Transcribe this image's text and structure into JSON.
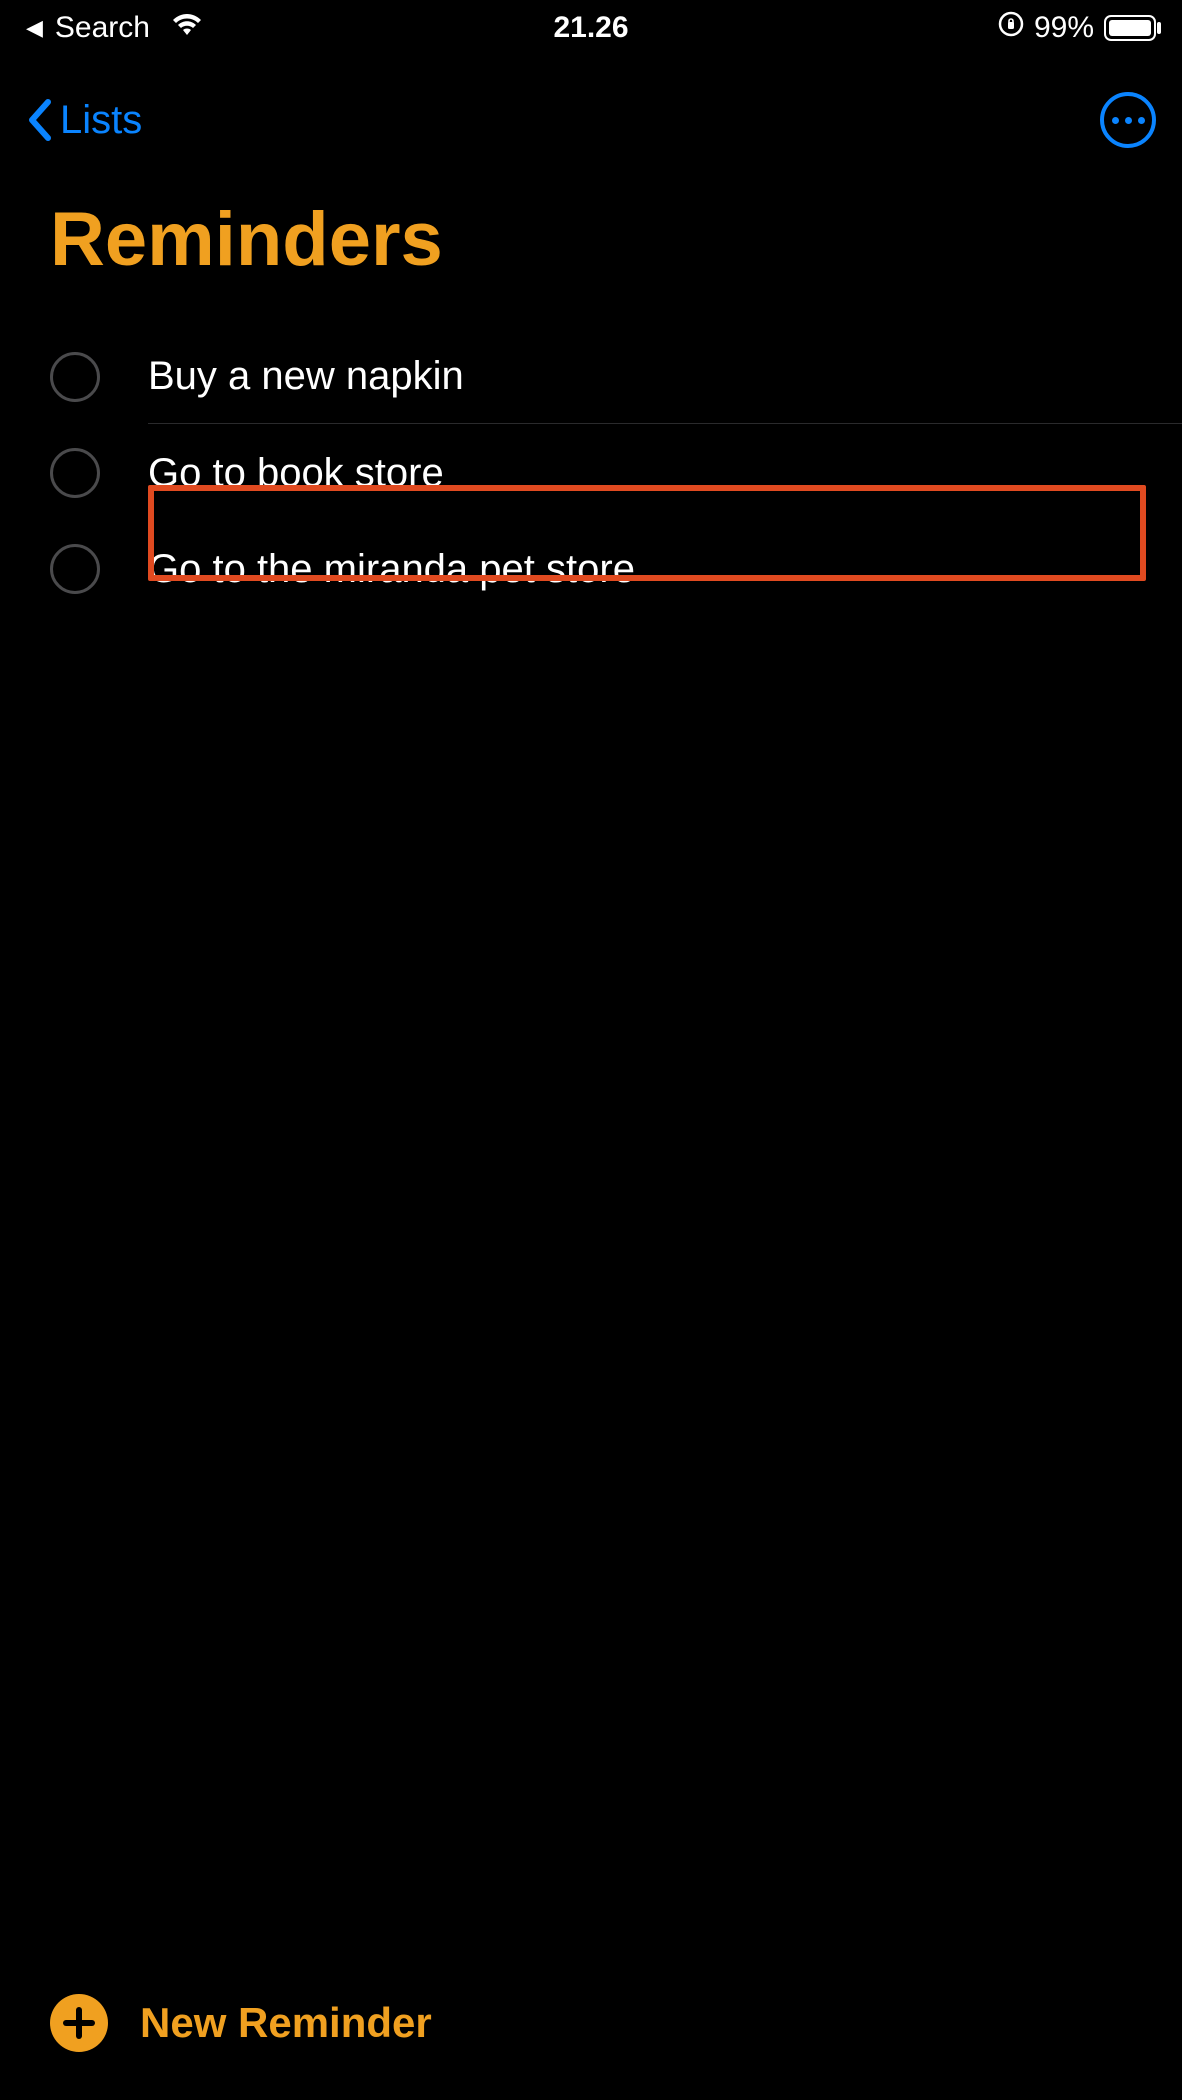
{
  "status_bar": {
    "back_app": "Search",
    "time": "21.26",
    "battery_text": "99%",
    "battery_fill_percent": 99
  },
  "nav": {
    "back_label": "Lists"
  },
  "title": "Reminders",
  "reminders": [
    {
      "text": "Buy a new napkin",
      "completed": false
    },
    {
      "text": "Go to book store",
      "completed": false
    },
    {
      "text": "Go to the miranda pet store",
      "completed": false,
      "highlighted": true
    }
  ],
  "footer": {
    "new_reminder_label": "New Reminder"
  },
  "colors": {
    "accent": "#f0a020",
    "link": "#0a84ff",
    "highlight": "#e04a20"
  }
}
